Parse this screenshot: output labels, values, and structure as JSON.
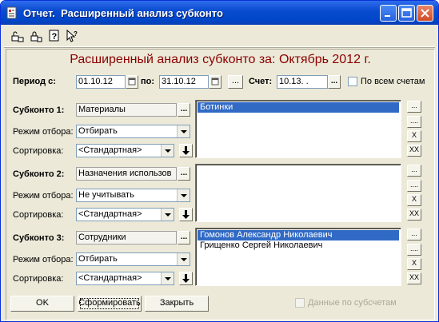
{
  "window": {
    "title": "Отчет.  Расширенный анализ субконто",
    "heading": "Расширенный анализ субконто за: Октябрь 2012 г."
  },
  "toolbar": {
    "icons": [
      "lock-open-icon",
      "lock-closed-icon",
      "help-icon",
      "pointer-help-icon"
    ]
  },
  "period": {
    "label": "Период с:",
    "from": "01.10.12",
    "to_label": "по:",
    "to": "31.10.12",
    "more_button": "...",
    "account_label": "Счет:",
    "account": "10.13. .",
    "account_button": "...",
    "all_accounts_label": "По всем счетам"
  },
  "subconto": [
    {
      "label": "Субконто 1:",
      "value": "Материалы",
      "mode_label": "Режим отбора:",
      "mode": "Отбирать",
      "sort_label": "Сортировка:",
      "sort": "<Стандартная>",
      "items": [
        "Ботинки"
      ],
      "selected": 0
    },
    {
      "label": "Субконто 2:",
      "value": "Назначения использов",
      "mode_label": "Режим отбора:",
      "mode": "Не учитывать",
      "sort_label": "Сортировка:",
      "sort": "<Стандартная>",
      "items": [],
      "selected": -1
    },
    {
      "label": "Субконто 3:",
      "value": "Сотрудники",
      "mode_label": "Режим отбора:",
      "mode": "Отбирать",
      "sort_label": "Сортировка:",
      "sort": "<Стандартная>",
      "items": [
        "Гомонов Александр Николаевич",
        "Грищенко Сергей Николаевич"
      ],
      "selected": 0
    }
  ],
  "side_buttons": [
    "...",
    "....",
    "X",
    "XX"
  ],
  "footer": {
    "ok": "OK",
    "generate": "Сформировать",
    "close": "Закрыть",
    "subaccounts_label": "Данные по субсчетам"
  }
}
